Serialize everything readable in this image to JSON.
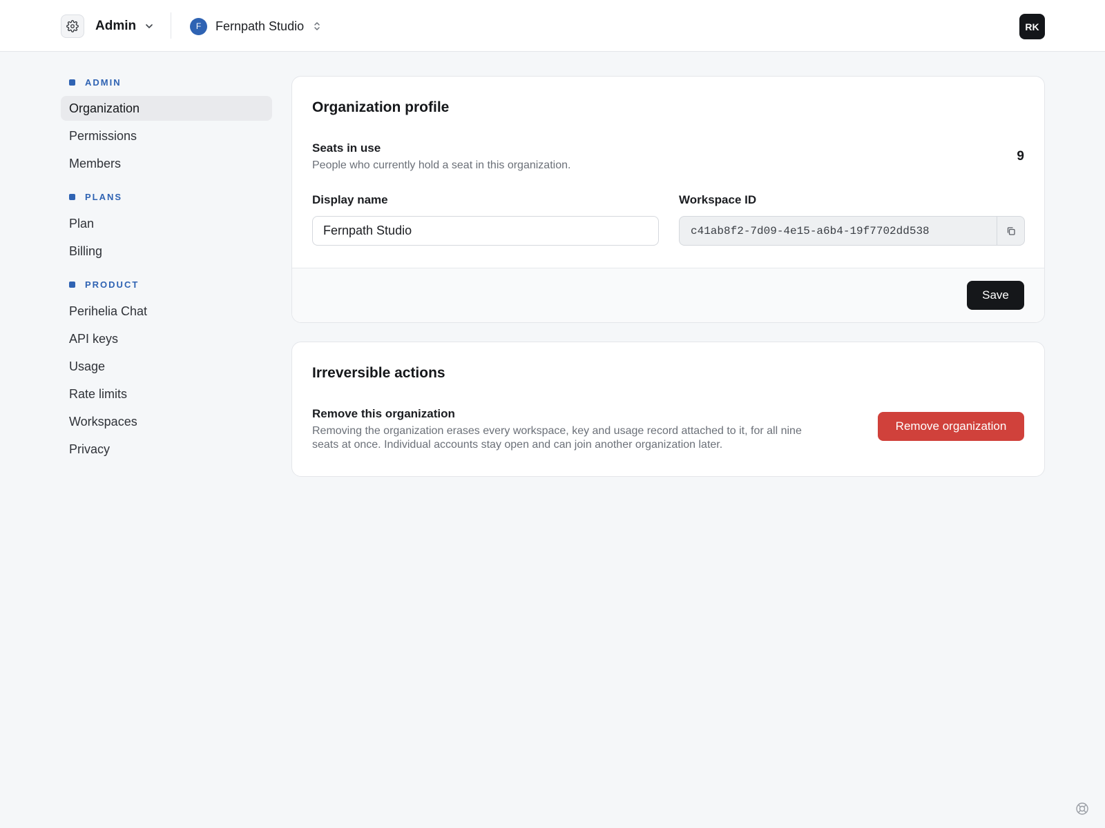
{
  "header": {
    "admin_label": "Admin",
    "org_initial": "F",
    "org_name": "Fernpath Studio",
    "user_initials": "RK"
  },
  "sidebar": {
    "sections": [
      {
        "label": "ADMIN",
        "items": [
          "Organization",
          "Permissions",
          "Members"
        ]
      },
      {
        "label": "PLANS",
        "items": [
          "Plan",
          "Billing"
        ]
      },
      {
        "label": "PRODUCT",
        "items": [
          "Perihelia Chat",
          "API keys",
          "Usage",
          "Rate limits",
          "Workspaces",
          "Privacy"
        ]
      }
    ],
    "active_item": "Organization"
  },
  "profile": {
    "title": "Organization profile",
    "seats_title": "Seats in use",
    "seats_desc": "People who currently hold a seat in this organization.",
    "seats_value": "9",
    "display_name_label": "Display name",
    "display_name_value": "Fernpath Studio",
    "workspace_id_label": "Workspace ID",
    "workspace_id_value": "c41ab8f2-7d09-4e15-a6b4-19f7702dd538",
    "save_label": "Save"
  },
  "danger": {
    "title": "Irreversible actions",
    "remove_title": "Remove this organization",
    "remove_desc_line1": "Removing the organization erases every workspace, key and usage record attached to it, for all nine",
    "remove_desc_line2": "seats at once. Individual accounts stay open and can join another organization later.",
    "remove_button": "Remove organization"
  },
  "colors": {
    "accent": "#2f63b3",
    "danger": "#d0413b",
    "primary_button": "#15171a",
    "background": "#f5f7f9"
  },
  "icons": {
    "settings": "gear-icon",
    "admin_dropdown": "chevron-down-icon",
    "org_switch": "chevron-updown-icon",
    "copy": "copy-icon",
    "help": "lifebuoy-icon"
  }
}
